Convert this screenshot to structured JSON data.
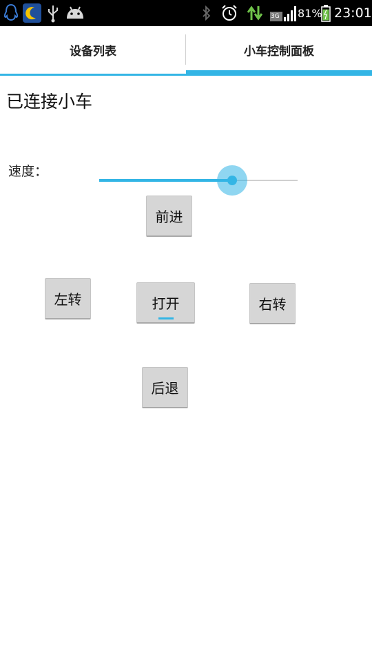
{
  "status_bar": {
    "left_icons": [
      "qq-penguin-icon",
      "moon-icon",
      "usb-icon",
      "android-debug-icon"
    ],
    "right_icons": [
      "bluetooth-icon",
      "alarm-icon",
      "data-transfer-icon",
      "signal-icon",
      "battery-icon"
    ],
    "network_type": "3G",
    "battery_percent": "81%",
    "battery_level": 0.81,
    "time": "23:01"
  },
  "tabs": [
    {
      "label": "设备列表",
      "selected": false
    },
    {
      "label": "小车控制面板",
      "selected": true
    }
  ],
  "main": {
    "connection_status": "已连接小车",
    "speed_label": "速度：",
    "speed_value": 0.67,
    "buttons": {
      "forward": "前进",
      "left": "左转",
      "open": "打开",
      "right": "右转",
      "back": "后退"
    }
  },
  "colors": {
    "accent": "#33b5e5",
    "status_bar": "#000000",
    "signal_green": "#6fc24a",
    "button_bg": "#d6d6d6"
  }
}
